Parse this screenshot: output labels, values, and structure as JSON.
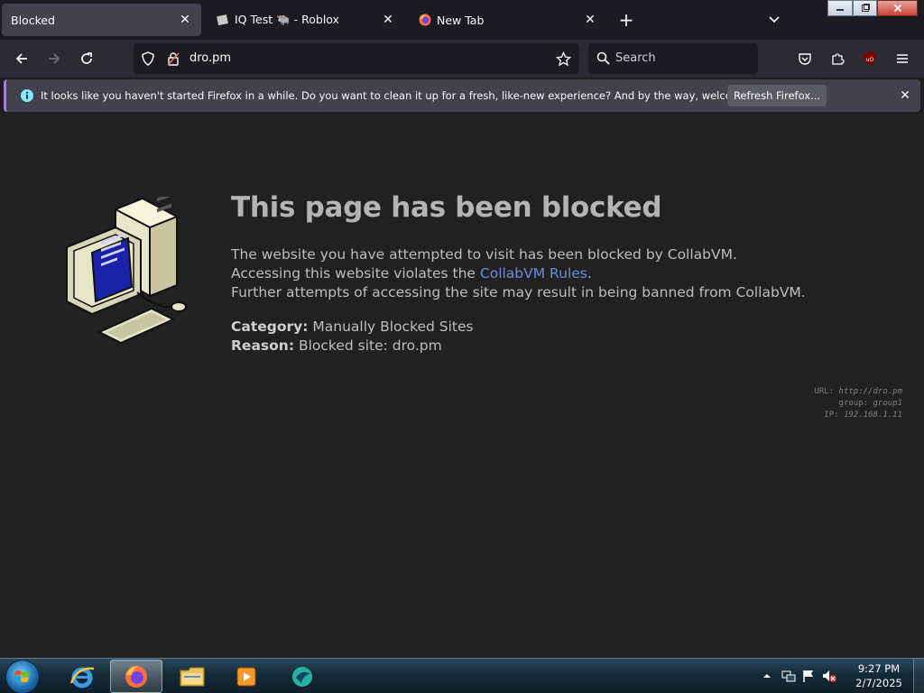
{
  "tabs": [
    {
      "title": "Blocked",
      "active": true
    },
    {
      "title": "IQ Test 🐃 - Roblox",
      "active": false
    },
    {
      "title": "New Tab",
      "active": false
    }
  ],
  "window_controls": {
    "minimize_icon": "minimize-icon",
    "maximize_icon": "maximize-icon",
    "close_icon": "close-icon"
  },
  "nav": {
    "url": "dro.pm",
    "search_placeholder": "Search"
  },
  "notification": {
    "message": "It looks like you haven't started Firefox in a while. Do you want to clean it up for a fresh, like-new experience? And by the way, welcome back!",
    "button_label": "Refresh Firefox..."
  },
  "page": {
    "title": "This page has been blocked",
    "line1": "The website you have attempted to visit has been blocked by CollabVM.",
    "line2_prefix": "Accessing this website violates the ",
    "line2_link": "CollabVM Rules",
    "line2_suffix": ".",
    "line3": "Further attempts of accessing the site may result in being banned from CollabVM.",
    "category_label": "Category:",
    "category_value": "Manually Blocked Sites",
    "reason_label": "Reason:",
    "reason_value": "Blocked site: dro.pm",
    "debug_url_label": "URL: ",
    "debug_url_value": "http://dro.pm",
    "debug_group_label": "group: ",
    "debug_group_value": "group1",
    "debug_ip_label": "IP: ",
    "debug_ip_value": "192.168.1.11"
  },
  "taskbar": {
    "time": "9:27 PM",
    "date": "2/7/2025"
  },
  "colors": {
    "accent_link": "#6c8ed6",
    "content_bg": "#212121",
    "toolbar_bg": "#2b2a33",
    "notice_accent": "#a47ee8"
  }
}
